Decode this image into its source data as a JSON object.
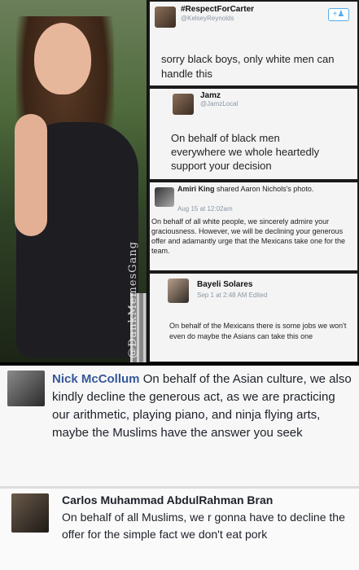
{
  "watermark": "@DankMemesGang",
  "post1": {
    "name": "#RespectForCarter",
    "handle": "@KelseyReynolds",
    "text": "sorry black boys, only white men can handle this"
  },
  "post2": {
    "name": "Jamz",
    "handle": "@JamzLocal",
    "text": "On behalf of black men everywhere we whole heartedly support your decision"
  },
  "post3": {
    "name": "Amiri King",
    "shared": "shared Aaron Nichols's photo.",
    "time": "Aug 15 at 12:02am",
    "text": "On behalf of all white people, we sincerely admire your graciousness. However, we will be declining your generous offer and adamantly urge that the Mexicans take one for the team."
  },
  "post4": {
    "name": "Bayeli Solares",
    "time": "Sep 1 at 2:48 AM Edited",
    "text": "On behalf of the Mexicans there is some jobs we won't even do maybe the Asians can take this one"
  },
  "post5": {
    "name": "Nick McCollum",
    "text": "On behalf of the Asian culture, we also kindly decline the generous act, as we are practicing our arithmetic, playing piano, and ninja flying arts, maybe the Muslims have the answer you seek"
  },
  "post6": {
    "name": "Carlos Muhammad AbdulRahman Bran",
    "text": "On behalf of all Muslims, we r gonna have to decline the offer for the simple fact we don't eat pork"
  }
}
